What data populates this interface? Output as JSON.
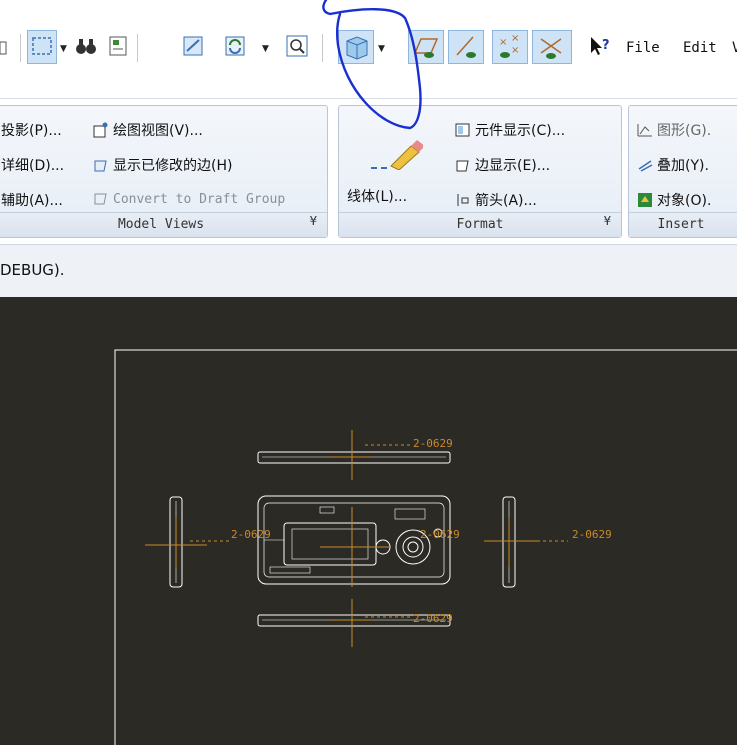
{
  "menus": {
    "file": "File",
    "edit": "Edit"
  },
  "groups": {
    "model_views": {
      "footer": "Model Views",
      "items": [
        {
          "label": "投影(P)..."
        },
        {
          "label": "详细(D)..."
        },
        {
          "label": "辅助(A)..."
        },
        {
          "label": "绘图视图(V)..."
        },
        {
          "label": "显示已修改的边(H)"
        },
        {
          "label": "Convert to Draft Group"
        }
      ]
    },
    "format": {
      "footer": "Format",
      "items": [
        {
          "label": "线体(L)..."
        },
        {
          "label": "元件显示(C)..."
        },
        {
          "label": "边显示(E)..."
        },
        {
          "label": "箭头(A)..."
        }
      ]
    },
    "insert": {
      "footer": "Insert",
      "items": [
        {
          "label": "图形(G)."
        },
        {
          "label": "叠加(Y)."
        },
        {
          "label": "对象(O)."
        }
      ]
    }
  },
  "status": {
    "message": "DEBUG)."
  },
  "drawing": {
    "dim_label": "2-0629"
  },
  "colors": {
    "canvas": "#2b2a24",
    "annotation": "#c98a2a",
    "line": "#ffffff",
    "ink": "#1a2fd0"
  }
}
